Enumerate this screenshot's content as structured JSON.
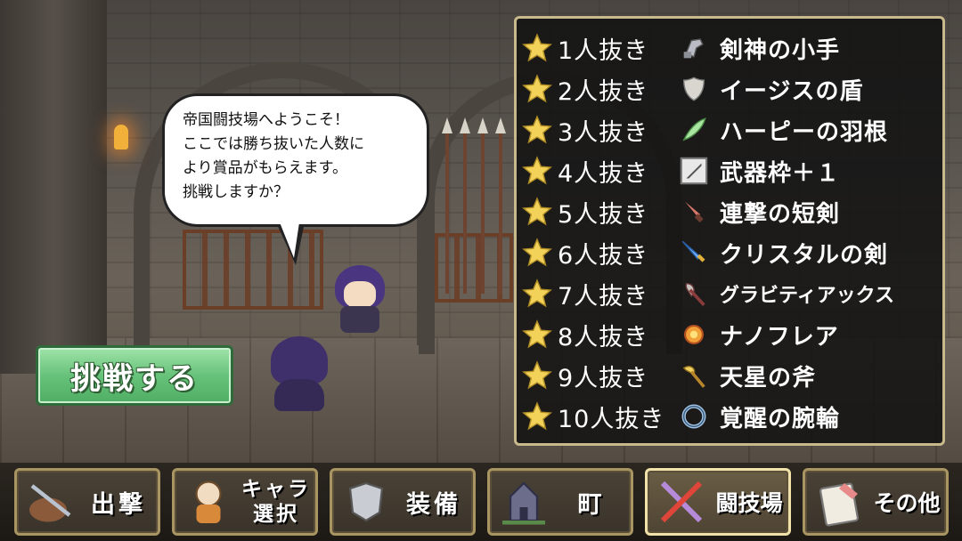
{
  "npc_dialog": {
    "lines": [
      "帝国闘技場へようこそ！",
      "ここでは勝ち抜いた人数に",
      "より賞品がもらえます。",
      "挑戦しますか？"
    ]
  },
  "challenge_button": {
    "label": "挑戦する"
  },
  "rewards": [
    {
      "tier": "1人抜き",
      "item": "剣神の小手",
      "icon": "gauntlet-icon"
    },
    {
      "tier": "2人抜き",
      "item": "イージスの盾",
      "icon": "shield-icon"
    },
    {
      "tier": "3人抜き",
      "item": "ハーピーの羽根",
      "icon": "feather-icon"
    },
    {
      "tier": "4人抜き",
      "item": "武器枠＋１",
      "icon": "weapon-slot-icon"
    },
    {
      "tier": "5人抜き",
      "item": "連撃の短剣",
      "icon": "dagger-icon"
    },
    {
      "tier": "6人抜き",
      "item": "クリスタルの剣",
      "icon": "crystal-sword-icon"
    },
    {
      "tier": "7人抜き",
      "item": "グラビティアックス",
      "icon": "axe-icon"
    },
    {
      "tier": "8人抜き",
      "item": "ナノフレア",
      "icon": "flare-icon"
    },
    {
      "tier": "9人抜き",
      "item": "天星の斧",
      "icon": "star-axe-icon"
    },
    {
      "tier": "10人抜き",
      "item": "覚醒の腕輪",
      "icon": "bracelet-icon"
    }
  ],
  "menu": [
    {
      "label": "出撃",
      "icon": "sortie-icon",
      "active": false
    },
    {
      "label": "キャラ 選択",
      "icon": "character-select-icon",
      "active": false
    },
    {
      "label": "装備",
      "icon": "equipment-icon",
      "active": false
    },
    {
      "label": "町",
      "icon": "town-icon",
      "active": false
    },
    {
      "label": "闘技場",
      "icon": "arena-icon",
      "active": true
    },
    {
      "label": "その他",
      "icon": "other-icon",
      "active": false
    }
  ],
  "colors": {
    "panel_border": "#c7b98c",
    "challenge_green": "#67c27a",
    "star_gold": "#f3d25a",
    "menu_border": "#a99561",
    "menu_active_border": "#f0e2a8"
  }
}
